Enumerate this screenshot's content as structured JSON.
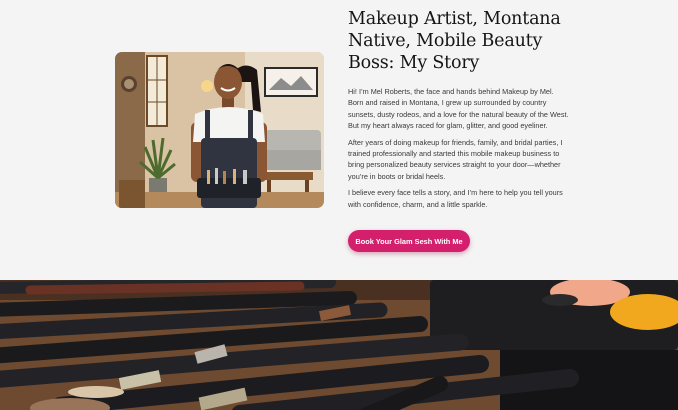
{
  "about": {
    "title": "Makeup Artist, Montana Native, Mobile Beauty Boss: My Story",
    "paragraphs": [
      "Hi! I’m Mel Roberts, the face and hands behind Makeup by Mel. Born and raised in Montana, I grew up surrounded by country sunsets, dusty rodeos, and a love for the natural beauty of the West. But my heart always raced for glam, glitter, and good eyeliner.",
      "After years of doing makeup for friends, family, and bridal parties, I trained professionally and started this mobile makeup business to bring personalized beauty services straight to your door—whether you’re in boots or bridal heels.",
      "I believe every face tells a story, and I’m here to help you tell yours with confidence, charm, and a little sparkle."
    ],
    "cta_label": "Book Your Glam Sesh With Me"
  },
  "colors": {
    "page_background": "#f4f4f4",
    "accent": "#d31f6c",
    "heading": "#151515",
    "body_text": "#3a3a3a"
  },
  "images": {
    "portrait": "photo-of-makeup-artist-in-living-room",
    "banner": "photo-of-makeup-brushes-and-eyeshadow-palette"
  }
}
